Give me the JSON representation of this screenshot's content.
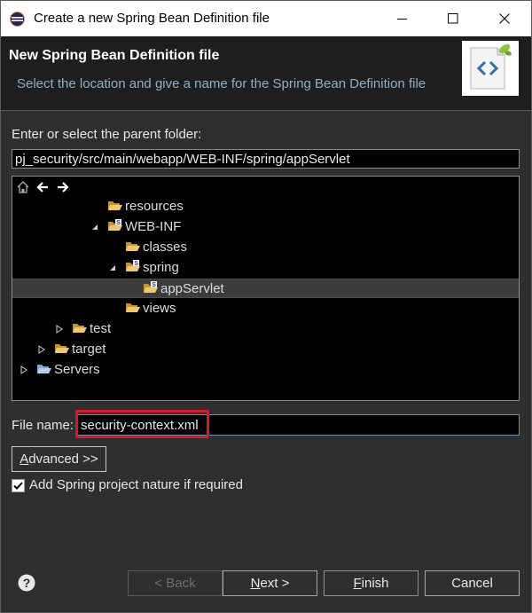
{
  "window": {
    "title": "Create a new Spring Bean Definition file"
  },
  "header": {
    "title": "New Spring Bean Definition file",
    "subtitle": "Select the location and give a name for the Spring Bean Definition file"
  },
  "folder": {
    "label": "Enter or select the parent folder:",
    "value": "pj_security/src/main/webapp/WEB-INF/spring/appServlet"
  },
  "tree": {
    "toolbar_icons": [
      "home-icon",
      "back-arrow-icon",
      "forward-arrow-icon"
    ],
    "items": [
      {
        "label": "resources",
        "icon": "folder-open-icon"
      },
      {
        "label": "WEB-INF",
        "icon": "spring-folder-icon",
        "expanded": true
      },
      {
        "label": "classes",
        "icon": "folder-open-icon"
      },
      {
        "label": "spring",
        "icon": "spring-folder-icon",
        "expanded": true
      },
      {
        "label": "appServlet",
        "icon": "spring-folder-icon",
        "selected": true
      },
      {
        "label": "views",
        "icon": "folder-open-icon"
      },
      {
        "label": "test",
        "icon": "folder-open-icon",
        "expanded": false
      },
      {
        "label": "target",
        "icon": "folder-open-icon",
        "expanded": false
      },
      {
        "label": "Servers",
        "icon": "server-folder-icon",
        "expanded": false
      }
    ]
  },
  "file": {
    "label": "File name:",
    "value": "security-context.xml"
  },
  "advanced": {
    "label_u": "A",
    "label_rest": "dvanced >>"
  },
  "nature": {
    "label": "Add Spring project nature if required",
    "checked": true
  },
  "buttons": {
    "back": "< Back",
    "next_u": "N",
    "next_rest": "ext >",
    "finish_u": "F",
    "finish_rest": "inish",
    "cancel": "Cancel"
  },
  "colors": {
    "highlight": "#e0161c",
    "subtitle": "#8fb0c4",
    "folder": "#f0b84a"
  }
}
